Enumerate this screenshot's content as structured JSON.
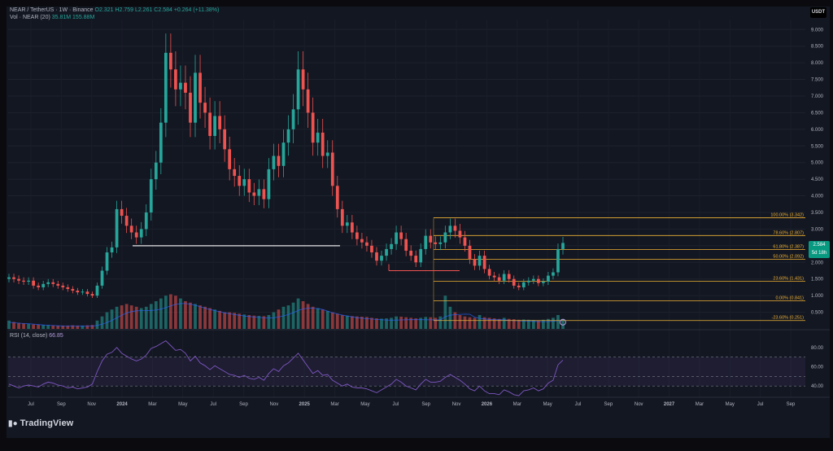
{
  "header": {
    "symbol": "NEAR / TetherUS · 1W · Binance",
    "ohlc": "O2.321 H2.759 L2.261 C2.584 +0.264 (+11.38%)",
    "volume": "Vol · NEAR (20)",
    "volume_values": "35.81M   155.88M",
    "quote_currency": "USDT"
  },
  "price_tag": {
    "value": "2.584",
    "countdown": "5d 18h"
  },
  "rsi": {
    "label": "RSI (14, close)",
    "value": "66.85",
    "levels": [
      "80.00",
      "60.00",
      "40.00"
    ]
  },
  "brand": {
    "name": "TradingView"
  },
  "colors": {
    "up": "#26a69a",
    "down": "#ef5350",
    "fib": "#f0b232",
    "rsi": "#7e57c2",
    "support": "#e6e6e6",
    "resistance": "#ef5350"
  },
  "chart_data": [
    {
      "type": "candlestick",
      "title": "NEAR / TetherUS · 1W · Binance",
      "x_ticks": [
        "Jul",
        "Sep",
        "Nov",
        "2024",
        "Mar",
        "May",
        "Jul",
        "Sep",
        "Nov",
        "2025",
        "Mar",
        "May",
        "Jul",
        "Sep",
        "Nov",
        "2026",
        "Mar",
        "May",
        "Jul",
        "Sep",
        "Nov",
        "2027",
        "Mar",
        "May",
        "Jul",
        "Sep"
      ],
      "y_ticks": [
        "9.000",
        "8.500",
        "8.000",
        "7.500",
        "7.000",
        "6.500",
        "6.000",
        "5.500",
        "5.000",
        "4.500",
        "4.000",
        "3.500",
        "3.000",
        "2.500",
        "2.000",
        "1.500",
        "1.000",
        "0.500"
      ],
      "ylim": [
        0.0,
        9.3
      ],
      "scale": "linear",
      "series": [
        {
          "name": "NEAR / TetherUS",
          "close": [
            1.55,
            1.5,
            1.45,
            1.42,
            1.45,
            1.3,
            1.25,
            1.35,
            1.4,
            1.35,
            1.3,
            1.25,
            1.2,
            1.15,
            1.1,
            1.12,
            1.05,
            1.0,
            1.3,
            1.75,
            2.3,
            2.45,
            3.6,
            3.4,
            3.1,
            2.9,
            2.75,
            3.0,
            3.5,
            4.5,
            5.0,
            6.2,
            8.3,
            7.8,
            7.2,
            7.4,
            7.1,
            6.2,
            7.7,
            6.8,
            6.5,
            5.8,
            6.4,
            6.0,
            5.4,
            4.8,
            4.6,
            4.3,
            4.5,
            4.1,
            4.0,
            4.2,
            3.9,
            4.8,
            5.2,
            4.9,
            5.6,
            6.0,
            6.6,
            7.8,
            7.2,
            6.5,
            5.6,
            5.9,
            5.2,
            5.3,
            4.3,
            3.6,
            3.1,
            3.2,
            2.9,
            2.7,
            2.6,
            2.5,
            2.3,
            2.05,
            2.2,
            2.4,
            2.55,
            2.9,
            2.7,
            2.35,
            2.2,
            2.0,
            2.4,
            2.8,
            2.6,
            2.55,
            2.6,
            2.9,
            3.1,
            2.95,
            2.75,
            2.5,
            2.1,
            1.9,
            2.2,
            1.8,
            1.6,
            1.55,
            1.45,
            1.65,
            1.5,
            1.3,
            1.25,
            1.4,
            1.45,
            1.5,
            1.38,
            1.42,
            1.6,
            1.7,
            2.4,
            2.584
          ]
        },
        {
          "name": "Vol · NEAR (20)",
          "values": [
            0.3,
            0.25,
            0.22,
            0.2,
            0.18,
            0.16,
            0.15,
            0.14,
            0.14,
            0.13,
            0.12,
            0.12,
            0.12,
            0.13,
            0.12,
            0.12,
            0.13,
            0.14,
            0.3,
            0.45,
            0.6,
            0.7,
            0.8,
            0.85,
            0.9,
            0.85,
            0.8,
            0.75,
            0.8,
            0.9,
            1.0,
            1.1,
            1.2,
            1.25,
            1.2,
            1.1,
            1.0,
            0.95,
            0.9,
            0.85,
            0.8,
            0.75,
            0.7,
            0.65,
            0.6,
            0.6,
            0.58,
            0.55,
            0.52,
            0.5,
            0.48,
            0.47,
            0.46,
            0.5,
            0.6,
            0.7,
            0.8,
            0.85,
            0.95,
            1.1,
            1.0,
            0.9,
            0.8,
            0.75,
            0.7,
            0.65,
            0.6,
            0.55,
            0.5,
            0.48,
            0.46,
            0.45,
            0.44,
            0.43,
            0.4,
            0.38,
            0.37,
            0.38,
            0.4,
            0.45,
            0.44,
            0.42,
            0.4,
            0.38,
            0.4,
            0.43,
            0.42,
            0.4,
            0.45,
            1.2,
            0.8,
            0.6,
            0.5,
            0.45,
            0.42,
            0.4,
            0.5,
            0.42,
            0.4,
            0.38,
            0.36,
            0.4,
            0.36,
            0.35,
            0.33,
            0.34,
            0.33,
            0.32,
            0.31,
            0.33,
            0.36,
            0.4,
            0.5,
            0.36
          ]
        }
      ],
      "fibonacci": [
        {
          "level": "100.00%",
          "price": 3.342,
          "label": "100.00% (3.342)"
        },
        {
          "level": "78.60%",
          "price": 2.807,
          "label": "78.60% (2.807)"
        },
        {
          "level": "61.80%",
          "price": 2.387,
          "label": "61.80% (2.387)"
        },
        {
          "level": "50.00%",
          "price": 2.092,
          "label": "50.00% (2.092)"
        },
        {
          "level": "23.60%",
          "price": 1.431,
          "label": "23.60% (1.431)"
        },
        {
          "level": "0.00%",
          "price": 0.841,
          "label": "0.00% (0.841)"
        },
        {
          "level": "-23.60%",
          "price": 0.251,
          "label": "-23.60% (0.251)"
        }
      ],
      "support_line": 2.5,
      "resistance_line": 1.75,
      "legend": "top-left",
      "grid": true
    },
    {
      "type": "line",
      "title": "RSI (14, close)",
      "ylim": [
        30,
        90
      ],
      "y_ticks": [
        "80.00",
        "60.00",
        "40.00"
      ],
      "band": [
        40,
        70
      ],
      "series": [
        {
          "name": "RSI (14, close)",
          "values": [
            42,
            40,
            38,
            40,
            41,
            40,
            39,
            42,
            44,
            43,
            41,
            40,
            38,
            39,
            37,
            38,
            39,
            42,
            55,
            66,
            73,
            75,
            80,
            74,
            71,
            68,
            66,
            68,
            72,
            79,
            81,
            84,
            87,
            82,
            77,
            78,
            74,
            66,
            71,
            64,
            61,
            57,
            61,
            58,
            55,
            52,
            51,
            49,
            51,
            48,
            47,
            49,
            46,
            53,
            58,
            55,
            61,
            64,
            69,
            74,
            67,
            60,
            53,
            56,
            51,
            52,
            46,
            43,
            40,
            42,
            39,
            38,
            38,
            37,
            35,
            33,
            36,
            39,
            42,
            47,
            44,
            40,
            38,
            36,
            42,
            47,
            44,
            44,
            45,
            49,
            52,
            49,
            46,
            42,
            37,
            35,
            40,
            35,
            32,
            32,
            31,
            36,
            34,
            31,
            30,
            35,
            36,
            38,
            35,
            37,
            43,
            46,
            62,
            66.85
          ]
        }
      ]
    }
  ]
}
